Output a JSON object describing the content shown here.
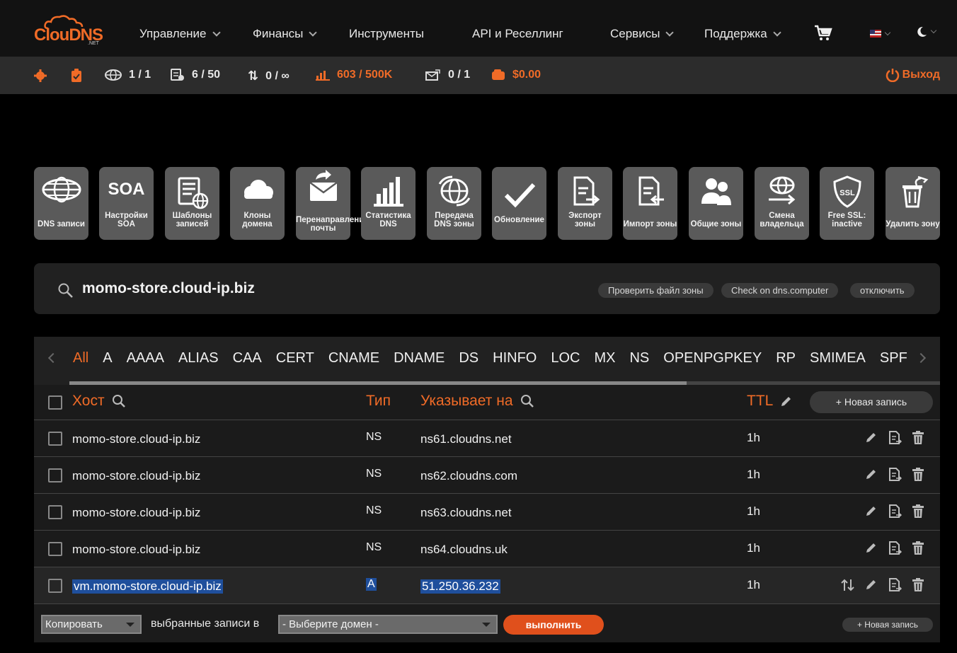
{
  "header": {
    "logo_text": "ClouDNS",
    "logo_sub": ".NET",
    "nav": [
      {
        "label": "Управление"
      },
      {
        "label": "Финансы"
      },
      {
        "label": "Инструменты"
      },
      {
        "label": "API и Реселлинг"
      },
      {
        "label": "Сервисы"
      },
      {
        "label": "Поддержка"
      }
    ]
  },
  "stats": {
    "zones": "1 / 1",
    "records": "6 / 50",
    "transfers": "0 / ∞",
    "queries": "603 / 500K",
    "mail": "0 / 1",
    "balance": "$0.00",
    "exit": "Выход"
  },
  "tiles": [
    {
      "label": "DNS записи",
      "icon": "globe-icon"
    },
    {
      "label": "Настройки SOA",
      "icon": "soa-icon",
      "icon_text": "SOA"
    },
    {
      "label": "Шаблоны записей",
      "icon": "template-icon"
    },
    {
      "label": "Клоны домена",
      "icon": "clouds-icon"
    },
    {
      "label": "Перенаправление почты",
      "icon": "mail-forward-icon"
    },
    {
      "label": "Статистика DNS",
      "icon": "bar-chart-icon"
    },
    {
      "label": "Передача DNS зоны",
      "icon": "globe-transfer-icon"
    },
    {
      "label": "Обновление",
      "icon": "check-icon"
    },
    {
      "label": "Экспорт зоны",
      "icon": "export-icon"
    },
    {
      "label": "Импорт зоны",
      "icon": "import-icon"
    },
    {
      "label": "Общие зоны",
      "icon": "users-icon"
    },
    {
      "label": "Смена владельца",
      "icon": "owner-change-icon"
    },
    {
      "label": "Free SSL: inactive",
      "icon": "ssl-icon",
      "icon_text": "SSL"
    },
    {
      "label": "Удалить зону",
      "icon": "trash-icon"
    }
  ],
  "zone": {
    "name": "momo-store.cloud-ip.biz",
    "actions": [
      "Проверить файл зоны",
      "Check on dns.computer",
      "отключить"
    ]
  },
  "record_types": [
    "All",
    "A",
    "AAAA",
    "ALIAS",
    "CAA",
    "CERT",
    "CNAME",
    "DNAME",
    "DS",
    "HINFO",
    "LOC",
    "MX",
    "NS",
    "OPENPGPKEY",
    "RP",
    "SMIMEA",
    "SPF"
  ],
  "active_type": "All",
  "table": {
    "headers": {
      "host": "Хост",
      "type": "Тип",
      "points_to": "Указывает на",
      "ttl": "TTL"
    },
    "new_record": "+ Новая запись",
    "rows": [
      {
        "host": "momo-store.cloud-ip.biz",
        "type": "NS",
        "value": "ns61.cloudns.net",
        "ttl": "1h"
      },
      {
        "host": "momo-store.cloud-ip.biz",
        "type": "NS",
        "value": "ns62.cloudns.com",
        "ttl": "1h"
      },
      {
        "host": "momo-store.cloud-ip.biz",
        "type": "NS",
        "value": "ns63.cloudns.net",
        "ttl": "1h"
      },
      {
        "host": "momo-store.cloud-ip.biz",
        "type": "NS",
        "value": "ns64.cloudns.uk",
        "ttl": "1h"
      },
      {
        "host": "vm.momo-store.cloud-ip.biz",
        "type": "A",
        "value": "51.250.36.232",
        "ttl": "1h"
      }
    ]
  },
  "bulk": {
    "action_select": "Копировать",
    "middle_text": "выбранные записи в",
    "domain_select": "- Выберите домен -",
    "run_button": "выполнить",
    "new_record_small": "+ Новая запись"
  },
  "colors": {
    "accent": "#f06b27",
    "tile_bg": "#5a5a5a",
    "selection": "#1f4f9c"
  }
}
